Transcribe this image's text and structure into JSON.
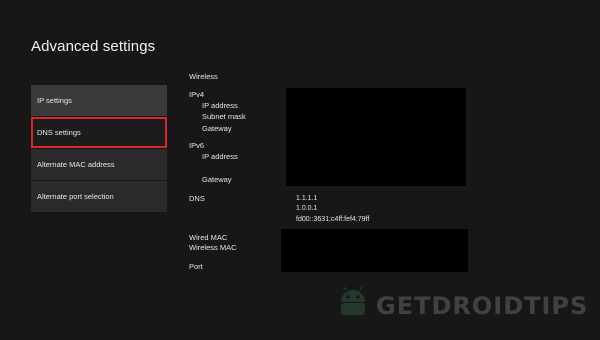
{
  "page": {
    "title": "Advanced settings"
  },
  "menu": [
    {
      "label": "IP settings"
    },
    {
      "label": "DNS settings"
    },
    {
      "label": "Alternate MAC address"
    },
    {
      "label": "Alternate port selection"
    }
  ],
  "details": {
    "wireless": "Wireless",
    "ipv4": "IPv4",
    "ip_address": "IP address",
    "subnet_mask": "Subnet mask",
    "gateway": "Gateway",
    "ipv6": "IPv6",
    "ipv6_ip_address": "IP address",
    "ipv6_gateway": "Gateway",
    "dns": "DNS",
    "dns_values": [
      "1.1.1.1",
      "1.0.0.1",
      "fd00::3631:c4ff:fef4:79ff"
    ],
    "wired_mac": "Wired MAC",
    "wireless_mac": "Wireless MAC",
    "port": "Port"
  },
  "watermark": {
    "text": "GETDROIDTIPS",
    "icon": "android-robot-icon"
  },
  "colors": {
    "background": "#171717",
    "menu_item": "#3a3a3a",
    "focus_border": "#d8262a"
  }
}
